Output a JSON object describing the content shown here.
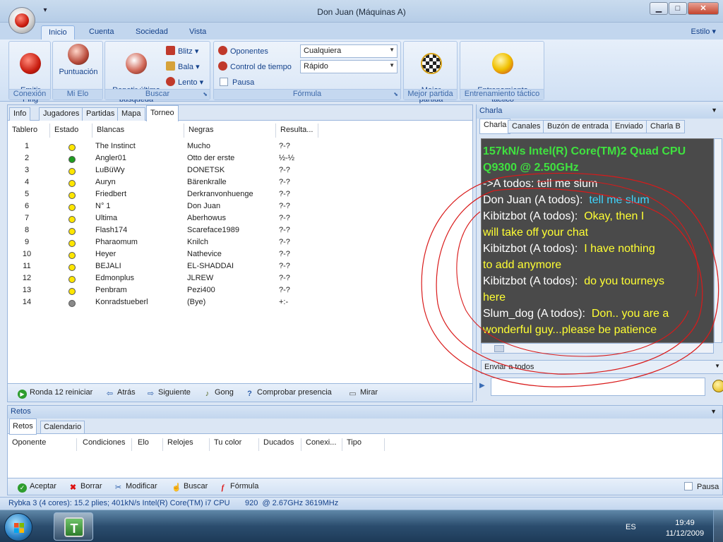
{
  "window": {
    "title": "Don Juan (Máquinas A)",
    "qat_glyph": "▾",
    "btn_min": "▁",
    "btn_max": "□",
    "btn_close": "✕"
  },
  "ribbon_tabs": [
    "Inicio",
    "Cuenta",
    "Sociedad",
    "Vista"
  ],
  "style_menu": "Estilo",
  "groups": {
    "conexion": {
      "label": "Conexión",
      "button": "Emitir\nPing"
    },
    "elo": {
      "label": "Mi Elo",
      "button": "Puntuación"
    },
    "buscar": {
      "label": "Buscar",
      "button": "Repetir última\nbúsqueda",
      "small": [
        "Blitz",
        "Bala",
        "Lento"
      ]
    },
    "formula": {
      "label": "Fórmula",
      "oponentes": "Oponentes",
      "oponentes_value": "Cualquiera",
      "control": "Control de tiempo",
      "control_value": "Rápido",
      "pausa": "Pausa"
    },
    "mejor": {
      "label": "Mejor partida",
      "button": "Mejor\npartida"
    },
    "entrenamiento": {
      "label": "Entrenamiento táctico",
      "button": "Entrenamiento\ntáctico"
    }
  },
  "left_tabs": [
    "Info",
    "Jugadores",
    "Partidas",
    "Mapa",
    "Torneo"
  ],
  "table": {
    "headers": [
      "Tablero",
      "Estado",
      "Blancas",
      "Negras",
      "Resulta..."
    ],
    "rows": [
      {
        "n": "1",
        "state": "yellow",
        "white": "The Instinct",
        "black": "Mucho",
        "res": "?-?"
      },
      {
        "n": "2",
        "state": "green",
        "white": "Angler01",
        "black": "Otto der erste",
        "res": "½-½"
      },
      {
        "n": "3",
        "state": "yellow",
        "white": "LuBüWy",
        "black": "DONETSK",
        "res": "?-?"
      },
      {
        "n": "4",
        "state": "yellow",
        "white": "Auryn",
        "black": "Bärenkralle",
        "res": "?-?"
      },
      {
        "n": "5",
        "state": "yellow",
        "white": "Friedbert",
        "black": "Derkranvonhuenge",
        "res": "?-?"
      },
      {
        "n": "6",
        "state": "yellow",
        "white": "N° 1",
        "black": "Don Juan",
        "res": "?-?"
      },
      {
        "n": "7",
        "state": "yellow",
        "white": "Ultima",
        "black": "Aberhowus",
        "res": "?-?"
      },
      {
        "n": "8",
        "state": "yellow",
        "white": "Flash174",
        "black": "Scareface1989",
        "res": "?-?"
      },
      {
        "n": "9",
        "state": "yellow",
        "white": "Pharaomum",
        "black": "Knilch",
        "res": "?-?"
      },
      {
        "n": "10",
        "state": "yellow",
        "white": "Heyer",
        "black": "Nathevice",
        "res": "?-?"
      },
      {
        "n": "11",
        "state": "yellow",
        "white": "BEJALI",
        "black": "EL-SHADDAI",
        "res": "?-?"
      },
      {
        "n": "12",
        "state": "yellow",
        "white": "Edmonplus",
        "black": "JLREW",
        "res": "?-?"
      },
      {
        "n": "13",
        "state": "yellow",
        "white": "Penbram",
        "black": "Pezi400",
        "res": "?-?"
      },
      {
        "n": "14",
        "state": "gray",
        "white": "Konradstueberl",
        "black": "(Bye)",
        "res": "+:-"
      }
    ]
  },
  "left_toolbar": [
    "Ronda 12 reiniciar",
    "Atrás",
    "Siguiente",
    "Gong",
    "Comprobar presencia",
    "Mirar"
  ],
  "chat": {
    "panel_title": "Charla",
    "tabs": [
      "Charla",
      "Canales",
      "Buzón de entrada",
      "Enviado",
      "Charla B"
    ],
    "lines": [
      {
        "t": "157kN/s Intel(R) Core(TM)2 Quad CPU",
        "c": "#3fe23f",
        "b": true
      },
      {
        "t": "Q9300 @ 2.50GHz",
        "c": "#3fe23f",
        "b": true
      },
      {
        "t": "->A todos: tell me slum",
        "c": "#ffffff"
      },
      {
        "t": "Don Juan (A todos):",
        "c": "#ffffff",
        "m": "tell me slum",
        "mc": "#3fd6ff"
      },
      {
        "t": "Kibitzbot (A todos):",
        "c": "#ffffff",
        "m": "Okay, then I",
        "mc": "#ffff33"
      },
      {
        "t": "will take off your chat",
        "c": "#ffff33"
      },
      {
        "t": "Kibitzbot (A todos):",
        "c": "#ffffff",
        "m": "I have nothing",
        "mc": "#ffff33"
      },
      {
        "t": "to add anymore",
        "c": "#ffff33"
      },
      {
        "t": "Kibitzbot (A todos):",
        "c": "#ffffff",
        "m": "do you tourneys",
        "mc": "#ffff33"
      },
      {
        "t": "here",
        "c": "#ffff33"
      },
      {
        "t": "Slum_dog (A todos):",
        "c": "#ffffff",
        "m": "Don.. you are a",
        "mc": "#ffff33"
      },
      {
        "t": "wonderful guy...please be patience",
        "c": "#ffff33"
      }
    ],
    "send_to": "Enviar a todos"
  },
  "retos": {
    "title": "Retos",
    "tabs": [
      "Retos",
      "Calendario"
    ],
    "headers": [
      "Oponente",
      "Condiciones",
      "Elo",
      "Relojes",
      "Tu color",
      "Ducados",
      "Conexi...",
      "Tipo"
    ],
    "toolbar": [
      "Aceptar",
      "Borrar",
      "Modificar",
      "Buscar",
      "Fórmula"
    ],
    "pausa": "Pausa"
  },
  "status": "Rybka 3 (4 cores): 15.2 plies; 401kN/s Intel(R) Core(TM) i7 CPU       920  @ 2.67GHz 3619MHz",
  "taskbar": {
    "app_letter": "T",
    "lang": "ES",
    "time": "19:49",
    "date": "11/12/2009"
  },
  "colors": {
    "accent": "#15428b",
    "dot_yellow": "#ffe600",
    "dot_green": "#1f9c1f",
    "dot_gray": "#8a8a8a",
    "scribble": "#d91a1a"
  }
}
